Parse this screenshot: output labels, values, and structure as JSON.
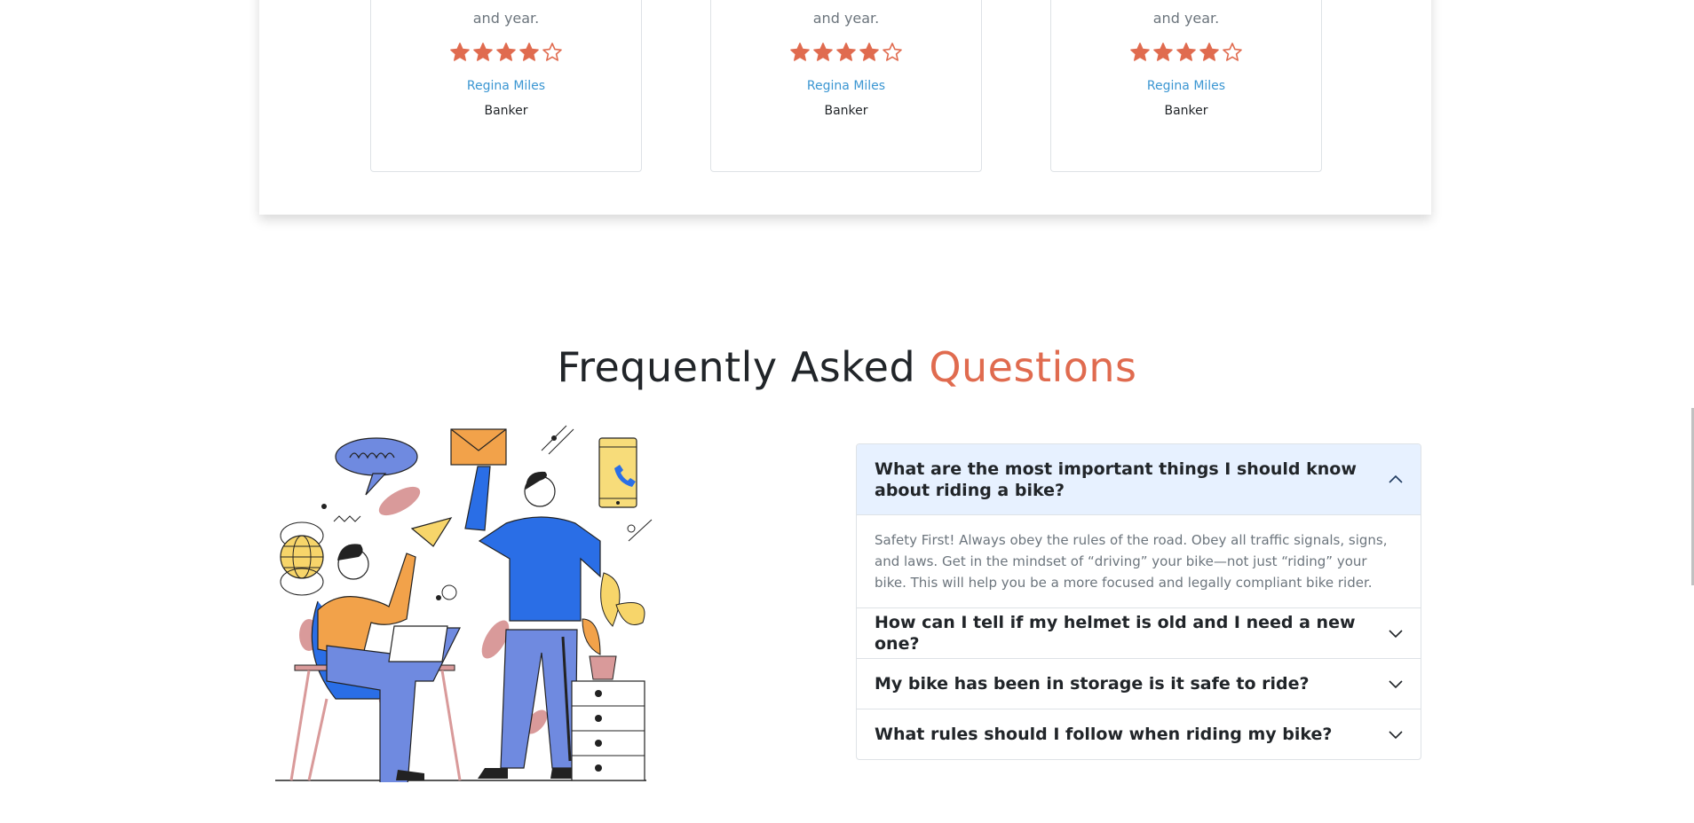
{
  "testimonials": [
    {
      "cut_text": "and year.",
      "rating": 4,
      "max_rating": 5,
      "name": "Regina Miles",
      "role": "Banker"
    },
    {
      "cut_text": "and year.",
      "rating": 4,
      "max_rating": 5,
      "name": "Regina Miles",
      "role": "Banker"
    },
    {
      "cut_text": "and year.",
      "rating": 4,
      "max_rating": 5,
      "name": "Regina Miles",
      "role": "Banker"
    }
  ],
  "faq": {
    "title_main": "Frequently Asked",
    "title_accent": "Questions",
    "items": [
      {
        "question": "What are the most important things I should know about riding a bike?",
        "answer": "Safety First! Always obey the rules of the road. Obey all traffic signals, signs, and laws. Get in the mindset of “driving” your bike—not just “riding” your bike. This will help you be a more focused and legally compliant bike rider.",
        "expanded": true
      },
      {
        "question": "How can I tell if my helmet is old and I need a new one?",
        "expanded": false
      },
      {
        "question": "My bike has been in storage is it safe to ride?",
        "expanded": false
      },
      {
        "question": "What rules should I follow when riding my bike?",
        "expanded": false
      }
    ]
  },
  "colors": {
    "accent": "#e06b4f",
    "star": "#e06b4f",
    "link": "#3b96d2",
    "accordion_active_bg": "#e7f1ff"
  },
  "icons": {
    "rating": "star-icon",
    "expanded": "chevron-up-icon",
    "collapsed": "chevron-down-icon"
  }
}
